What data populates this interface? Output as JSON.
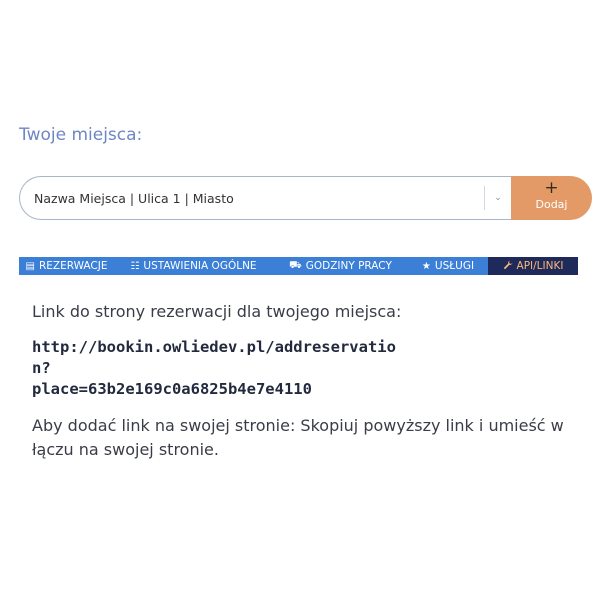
{
  "section_title": "Twoje miejsca:",
  "place_select": {
    "value": "Nazwa Miejsca | Ulica 1 | Miasto",
    "chevron": "⌄"
  },
  "add_button": {
    "icon": "+",
    "label": "Dodaj"
  },
  "tabs": [
    {
      "icon": "document-icon",
      "glyph": "▤",
      "label": "REZERWACJE"
    },
    {
      "icon": "list-settings-icon",
      "glyph": "☷",
      "label": "USTAWIENIA OGÓLNE"
    },
    {
      "icon": "clock-group-icon",
      "glyph": "⛟",
      "label": "GODZINY PRACY"
    },
    {
      "icon": "star-icon",
      "glyph": "★",
      "label": "USŁUGI"
    },
    {
      "icon": "wrench-icon",
      "glyph": "🔧",
      "label": "API/LINKI",
      "active": true
    }
  ],
  "content": {
    "lead": "Link do strony rezerwacji dla twojego miejsca:",
    "link_line1": "http://bookin.owliedev.pl/addreservation?",
    "link_line2": "place=63b2e169c0a6825b4e7e4110",
    "note": "Aby dodać link na swojej stronie: Skopiuj powyższy link i umieść w łączu na swojej stronie."
  },
  "colors": {
    "title": "#6e86c4",
    "tab_bar": "#3b7fd6",
    "tab_active_bg": "#1d2a5a",
    "tab_active_text": "#ffb77a",
    "add_button": "#e39a66"
  }
}
